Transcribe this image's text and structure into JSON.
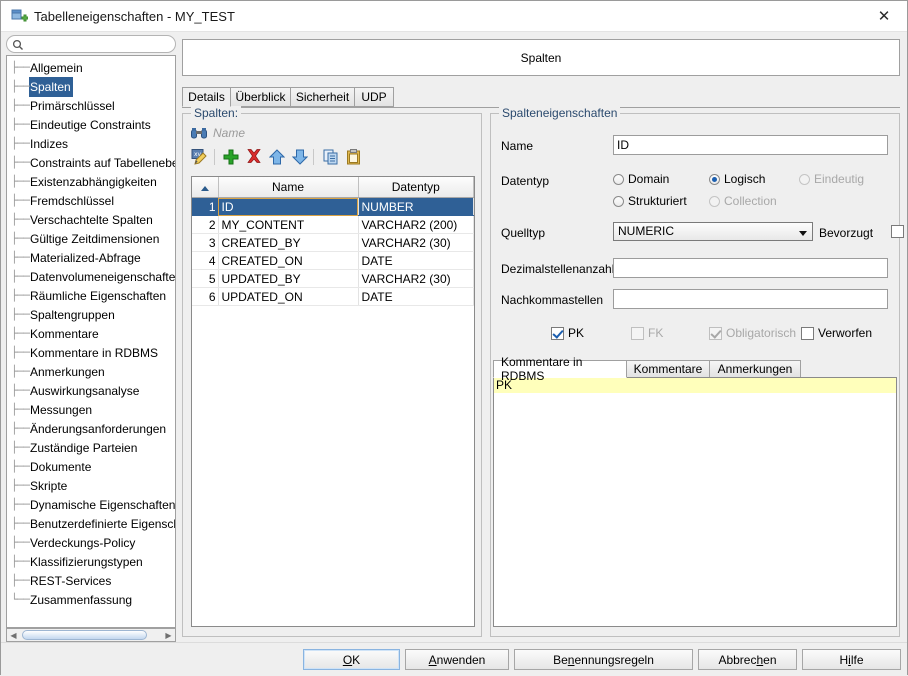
{
  "window": {
    "title": "Tabelleneigenschaften - MY_TEST",
    "icon": "table-properties-icon",
    "close_label": "✕"
  },
  "sidebar": {
    "search": {
      "value": "",
      "placeholder": "",
      "icon": "search-icon"
    },
    "selected": "Spalten",
    "items": [
      "Allgemein",
      "Spalten",
      "Primärschlüssel",
      "Eindeutige Constraints",
      "Indizes",
      "Constraints auf Tabellenebene",
      "Existenzabhängigkeiten",
      "Fremdschlüssel",
      "Verschachtelte Spalten",
      "Gültige Zeitdimensionen",
      "Materialized-Abfrage",
      "Datenvolumeneigenschaften",
      "Räumliche Eigenschaften",
      "Spaltengruppen",
      "Kommentare",
      "Kommentare in RDBMS",
      "Anmerkungen",
      "Auswirkungsanalyse",
      "Messungen",
      "Änderungsanforderungen",
      "Zuständige Parteien",
      "Dokumente",
      "Skripte",
      "Dynamische Eigenschaften",
      "Benutzerdefinierte Eigenschaft",
      "Verdeckungs-Policy",
      "Klassifizierungstypen",
      "REST-Services",
      "Zusammenfassung"
    ]
  },
  "main": {
    "header_title": "Spalten",
    "tabs": [
      {
        "label": "Details",
        "active": true
      },
      {
        "label": "Überblick",
        "active": false
      },
      {
        "label": "Sicherheit",
        "active": false
      },
      {
        "label": "UDP",
        "active": false
      }
    ]
  },
  "columns_panel": {
    "group_title": "Spalten:",
    "find_icon": "binoculars-icon",
    "find_label": "Name",
    "toolbar": [
      {
        "name": "edit-icon",
        "glyph": "edit"
      },
      {
        "name": "add-icon",
        "glyph": "plus"
      },
      {
        "name": "delete-icon",
        "glyph": "cross"
      },
      {
        "name": "move-up-icon",
        "glyph": "up"
      },
      {
        "name": "move-down-icon",
        "glyph": "down"
      },
      {
        "name": "copy-icon",
        "glyph": "copy"
      },
      {
        "name": "paste-icon",
        "glyph": "paste"
      }
    ],
    "table": {
      "headers": [
        "",
        "Name",
        "Datentyp"
      ],
      "rows": [
        {
          "n": "1",
          "name": "ID",
          "type": "NUMBER",
          "selected": true
        },
        {
          "n": "2",
          "name": "MY_CONTENT",
          "type": "VARCHAR2 (200)",
          "selected": false
        },
        {
          "n": "3",
          "name": "CREATED_BY",
          "type": "VARCHAR2 (30)",
          "selected": false
        },
        {
          "n": "4",
          "name": "CREATED_ON",
          "type": "DATE",
          "selected": false
        },
        {
          "n": "5",
          "name": "UPDATED_BY",
          "type": "VARCHAR2 (30)",
          "selected": false
        },
        {
          "n": "6",
          "name": "UPDATED_ON",
          "type": "DATE",
          "selected": false
        }
      ]
    }
  },
  "properties_panel": {
    "group_title": "Spalteneigenschaften",
    "name_label": "Name",
    "name_value": "ID",
    "datatype_label": "Datentyp",
    "datatype_options": [
      {
        "label": "Domain",
        "checked": false,
        "disabled": false
      },
      {
        "label": "Logisch",
        "checked": true,
        "disabled": false
      },
      {
        "label": "Eindeutig",
        "checked": false,
        "disabled": true
      },
      {
        "label": "Strukturiert",
        "checked": false,
        "disabled": false
      },
      {
        "label": "Collection",
        "checked": false,
        "disabled": true
      }
    ],
    "sourcetype_label": "Quelltyp",
    "sourcetype_value": "NUMERIC",
    "preferred_label": "Bevorzugt",
    "preferred_checked": false,
    "precision_label": "Dezimalstellenanzahl",
    "precision_value": "",
    "scale_label": "Nachkommastellen",
    "scale_value": "",
    "flags": [
      {
        "label": "PK",
        "checked": true,
        "disabled": false
      },
      {
        "label": "FK",
        "checked": false,
        "disabled": true
      },
      {
        "label": "Obligatorisch",
        "checked": true,
        "disabled": true
      },
      {
        "label": "Verworfen",
        "checked": false,
        "disabled": false
      }
    ],
    "comment_tabs": [
      {
        "label": "Kommentare in RDBMS",
        "active": true
      },
      {
        "label": "Kommentare",
        "active": false
      },
      {
        "label": "Anmerkungen",
        "active": false
      }
    ],
    "comment_text": "PK"
  },
  "buttons": [
    {
      "label": "OK",
      "mnemonic_index": 0,
      "default": true
    },
    {
      "label": "Anwenden",
      "mnemonic_index": 0,
      "default": false
    },
    {
      "label": "Benennungsregeln",
      "mnemonic_index": 2,
      "default": false
    },
    {
      "label": "Abbrechen",
      "mnemonic_index": 6,
      "default": false
    },
    {
      "label": "Hilfe",
      "mnemonic_index": 1,
      "default": false
    }
  ],
  "colors": {
    "selection": "#2f6096",
    "accent_group_title": "#2b4a6e",
    "comment_highlight": "#ffffbb",
    "focus_cell": "#d8a244"
  }
}
